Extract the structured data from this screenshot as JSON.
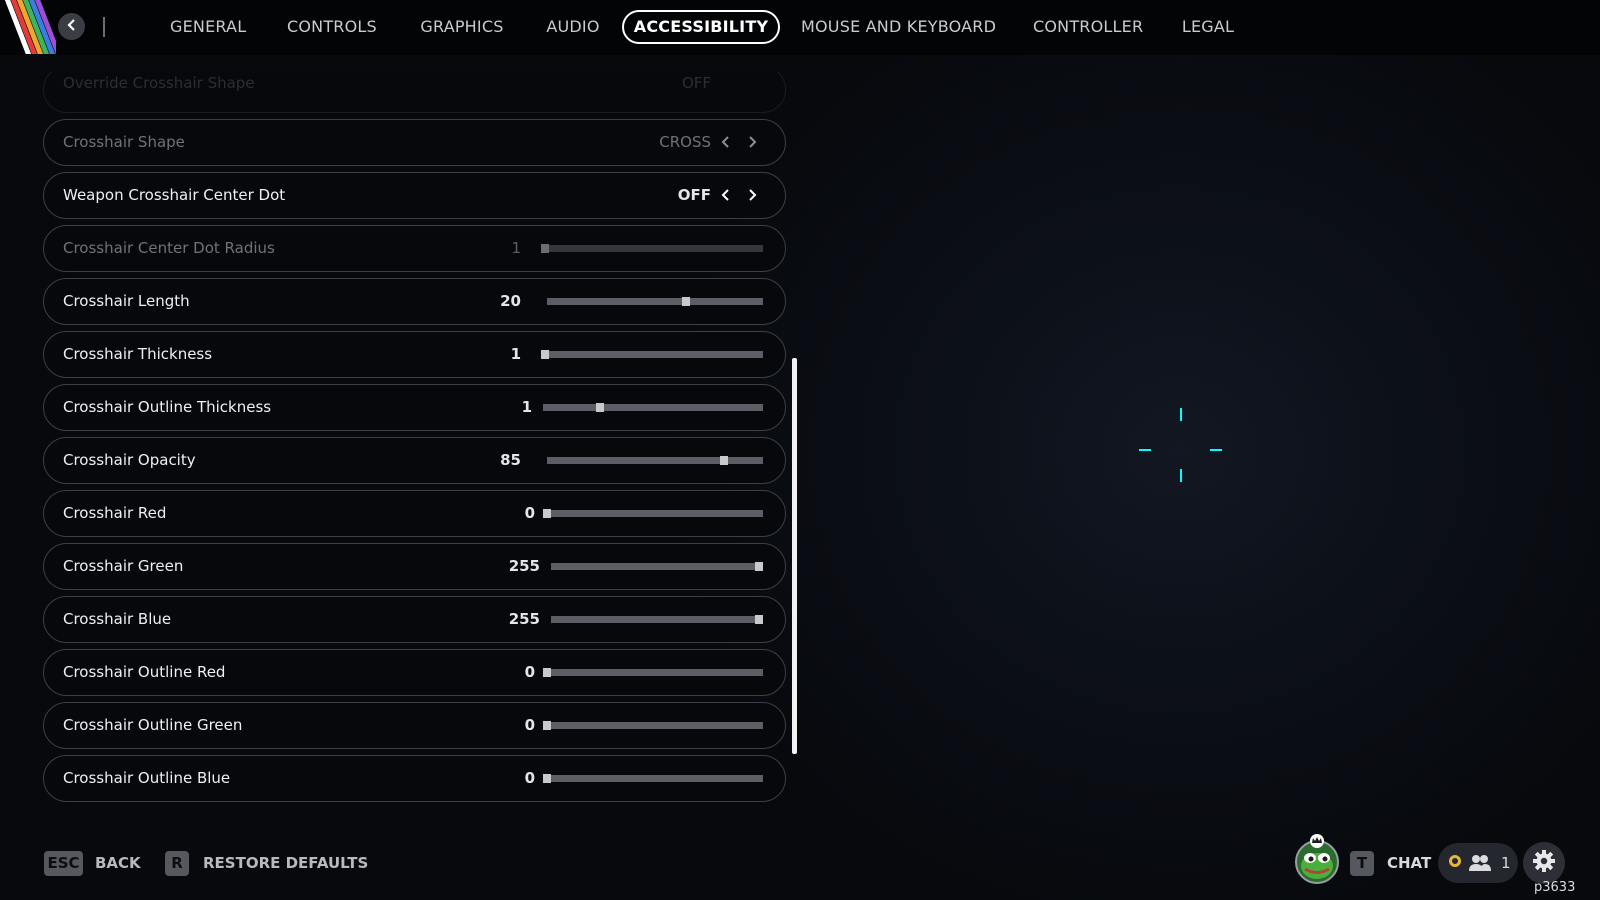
{
  "topbar": {
    "tabs": [
      {
        "label": "GENERAL"
      },
      {
        "label": "CONTROLS"
      },
      {
        "label": "GRAPHICS"
      },
      {
        "label": "AUDIO"
      },
      {
        "label": "ACCESSIBILITY",
        "active": true
      },
      {
        "label": "MOUSE AND KEYBOARD"
      },
      {
        "label": "CONTROLLER"
      },
      {
        "label": "LEGAL"
      }
    ],
    "back_icon": "chevron-left-icon"
  },
  "settings": {
    "rows": [
      {
        "label": "Override Crosshair Shape",
        "type": "toggle",
        "value": "OFF",
        "dim": true,
        "partially_hidden": true
      },
      {
        "label": "Crosshair Shape",
        "type": "toggle",
        "value": "CROSS",
        "dim": true
      },
      {
        "label": "Weapon Crosshair Center Dot",
        "type": "toggle",
        "value": "OFF"
      },
      {
        "label": "Crosshair Center Dot Radius",
        "type": "slider",
        "value": "1",
        "level": 0.0,
        "dim": true
      },
      {
        "label": "Crosshair Length",
        "type": "slider",
        "value": "20",
        "level": 0.65
      },
      {
        "label": "Crosshair Thickness",
        "type": "slider",
        "value": "1",
        "level": 0.0
      },
      {
        "label": "Crosshair Outline Thickness",
        "type": "slider",
        "value": "1",
        "level": 0.25
      },
      {
        "label": "Crosshair Opacity",
        "type": "slider",
        "value": "85",
        "level": 0.83
      },
      {
        "label": "Crosshair Red",
        "type": "slider",
        "value": "0",
        "level": 0.0
      },
      {
        "label": "Crosshair Green",
        "type": "slider",
        "value": "255",
        "level": 1.0
      },
      {
        "label": "Crosshair Blue",
        "type": "slider",
        "value": "255",
        "level": 1.0
      },
      {
        "label": "Crosshair Outline Red",
        "type": "slider",
        "value": "0",
        "level": 0.0
      },
      {
        "label": "Crosshair Outline Green",
        "type": "slider",
        "value": "0",
        "level": 0.0
      },
      {
        "label": "Crosshair Outline Blue",
        "type": "slider",
        "value": "0",
        "level": 0.0
      }
    ]
  },
  "preview": {
    "crosshair_color": "#00ffff"
  },
  "footer": {
    "back_key": "ESC",
    "back_label": "BACK",
    "restore_key": "R",
    "restore_label": "RESTORE DEFAULTS",
    "chat_key": "T",
    "chat_label": "CHAT",
    "party_count": "1",
    "build_id": "p3633",
    "icons": [
      "avatar-icon",
      "party-icon",
      "gear-icon"
    ]
  },
  "colors": {
    "background": "#07090d",
    "row_border": "#3b3f47",
    "party_status": "#e9b53a"
  }
}
